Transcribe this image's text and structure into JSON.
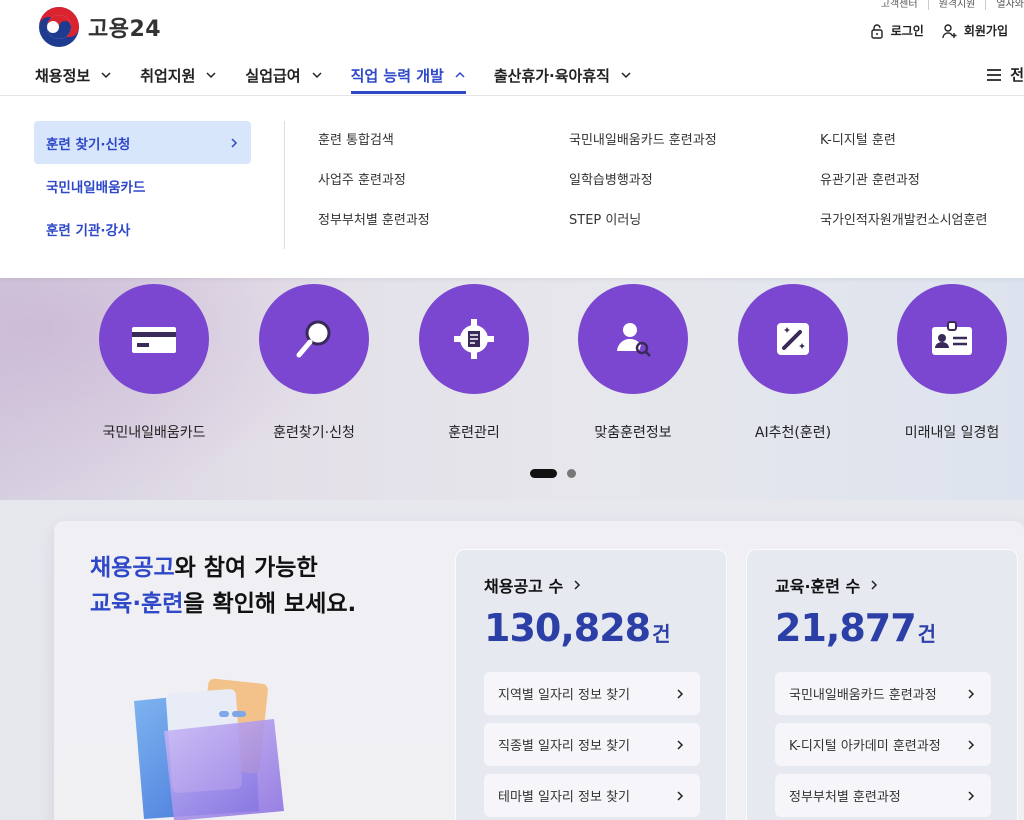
{
  "header": {
    "logo_text": "고용24",
    "util_links": [
      "고객센터",
      "원격지원",
      "열자와"
    ],
    "login_label": "로그인",
    "signup_label": "회원가입",
    "all_menu_label": "전"
  },
  "gnb": [
    {
      "label": "채용정보"
    },
    {
      "label": "취업지원"
    },
    {
      "label": "실업급여"
    },
    {
      "label": "직업 능력 개발",
      "active": true
    },
    {
      "label": "출산휴가·육아휴직"
    }
  ],
  "dropdown": {
    "side": [
      {
        "label": "훈련 찾기·신청",
        "active": true
      },
      {
        "label": "국민내일배움카드"
      },
      {
        "label": "훈련 기관·강사"
      }
    ],
    "links": [
      "훈련 통합검색",
      "국민내일배움카드 훈련과정",
      "K-디지털 훈련",
      "사업주 훈련과정",
      "일학습병행과정",
      "유관기관 훈련과정",
      "정부부처별 훈련과정",
      "STEP 이러닝",
      "국가인적자원개발컨소시엄훈련"
    ]
  },
  "quick": [
    {
      "label": "국민내일배움카드",
      "icon": "card-icon"
    },
    {
      "label": "훈련찾기·신청",
      "icon": "magnifier-icon"
    },
    {
      "label": "훈련관리",
      "icon": "gear-document-icon"
    },
    {
      "label": "맞춤훈련정보",
      "icon": "person-search-icon"
    },
    {
      "label": "AI추천(훈련)",
      "icon": "magic-wand-icon"
    },
    {
      "label": "미래내일 일경험",
      "icon": "id-badge-icon"
    }
  ],
  "headline": {
    "part1_blue": "채용공고",
    "part1_rest": "와 참여 가능한",
    "part2_blue": "교육·훈련",
    "part2_rest": "을 확인해 보세요."
  },
  "cards": [
    {
      "title": "채용공고 수",
      "count": "130,828",
      "unit": "건",
      "links": [
        "지역별 일자리 정보 찾기",
        "직종별 일자리 정보 찾기",
        "테마별 일자리 정보 찾기"
      ]
    },
    {
      "title": "교육·훈련 수",
      "count": "21,877",
      "unit": "건",
      "links": [
        "국민내일배움카드 훈련과정",
        "K-디지털 아카데미 훈련과정",
        "정부부처별 훈련과정"
      ]
    }
  ],
  "colors": {
    "accent_blue": "#2e48c8",
    "quick_purple": "#7b47d0",
    "count_blue": "#2b3fa6",
    "active_side_bg": "#d8e6fb"
  }
}
